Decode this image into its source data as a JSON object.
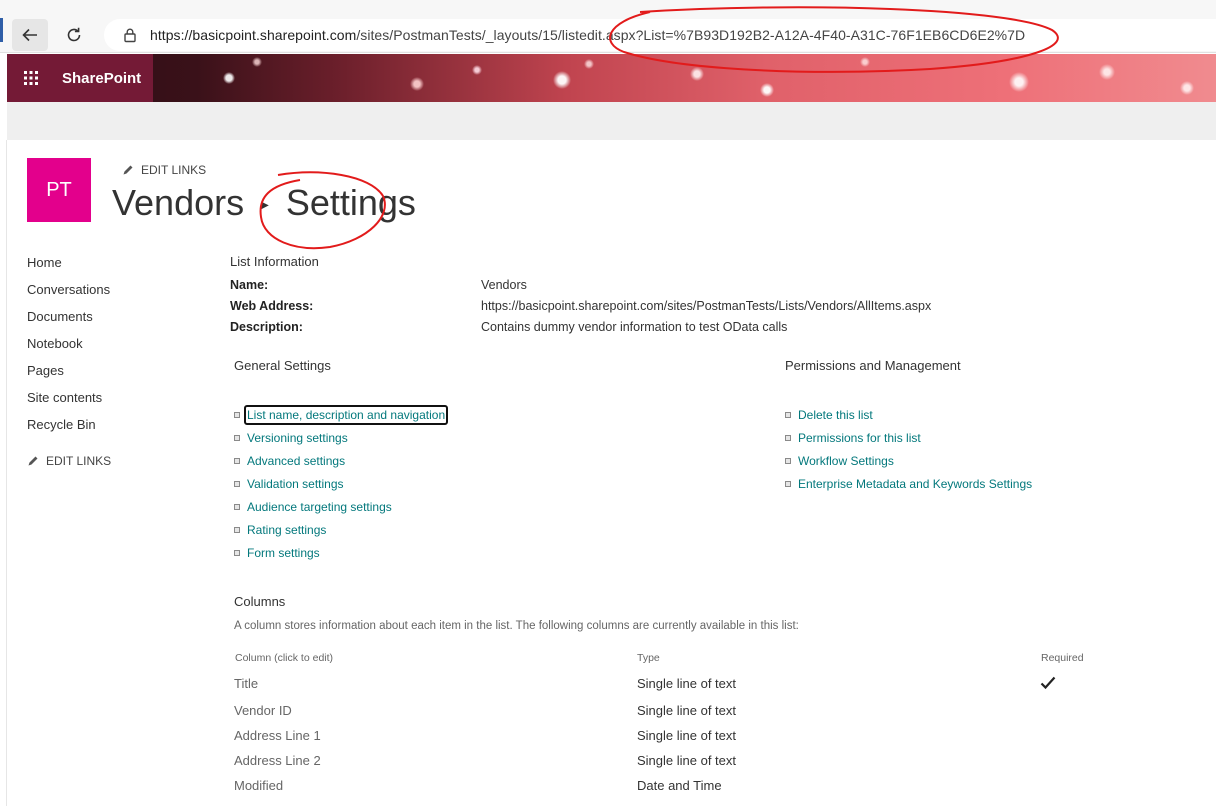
{
  "browser": {
    "url_host": "https://basicpoint.sharepoint.com",
    "url_path": "/sites/PostmanTests/_layouts/15/listedit.aspx?List=%7B93D192B2-A12A-4F40-A31C-76F1EB6CD6E2%7D"
  },
  "suite": {
    "brand": "SharePoint"
  },
  "site": {
    "logo_text": "PT",
    "edit_links": "EDIT LINKS",
    "breadcrumb_list": "Vendors",
    "breadcrumb_page": "Settings"
  },
  "nav": {
    "items": [
      "Home",
      "Conversations",
      "Documents",
      "Notebook",
      "Pages",
      "Site contents",
      "Recycle Bin"
    ],
    "edit_links": "EDIT LINKS"
  },
  "list_info": {
    "heading": "List Information",
    "name_label": "Name:",
    "name_value": "Vendors",
    "web_label": "Web Address:",
    "web_value": "https://basicpoint.sharepoint.com/sites/PostmanTests/Lists/Vendors/AllItems.aspx",
    "desc_label": "Description:",
    "desc_value": "Contains dummy vendor information to test OData calls"
  },
  "general": {
    "heading": "General Settings",
    "links": [
      "List name, description and navigation",
      "Versioning settings",
      "Advanced settings",
      "Validation settings",
      "Audience targeting settings",
      "Rating settings",
      "Form settings"
    ]
  },
  "permissions": {
    "heading": "Permissions and Management",
    "links": [
      "Delete this list",
      "Permissions for this list",
      "Workflow Settings",
      "Enterprise Metadata and Keywords Settings"
    ]
  },
  "columns": {
    "heading": "Columns",
    "description": "A column stores information about each item in the list. The following columns are currently available in this list:",
    "headers": {
      "name": "Column (click to edit)",
      "type": "Type",
      "required": "Required"
    },
    "rows": [
      {
        "name": "Title",
        "type": "Single line of text",
        "required": true
      },
      {
        "name": "Vendor ID",
        "type": "Single line of text",
        "required": false
      },
      {
        "name": "Address Line 1",
        "type": "Single line of text",
        "required": false
      },
      {
        "name": "Address Line 2",
        "type": "Single line of text",
        "required": false
      },
      {
        "name": "Modified",
        "type": "Date and Time",
        "required": false
      }
    ]
  },
  "colors": {
    "link": "#03787c",
    "site_logo": "#e3008c",
    "waffle_bg": "#741a36",
    "annotation": "#e21b1b"
  }
}
